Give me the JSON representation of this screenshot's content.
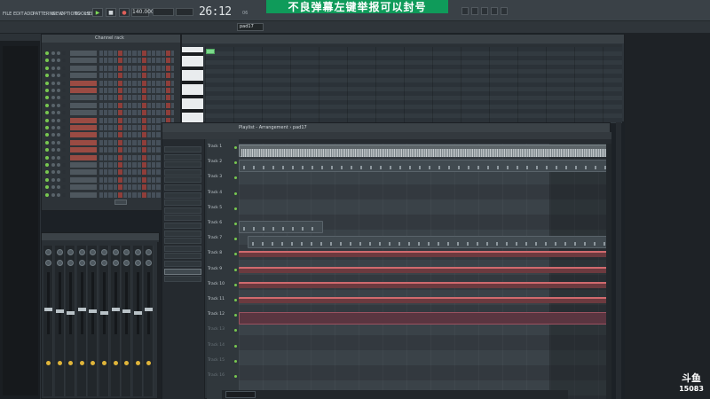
{
  "menubar": {
    "items": [
      "FILE",
      "EDIT",
      "ADD",
      "PATTERNS",
      "VIEW",
      "OPTIONS",
      "TOOLS",
      "HELP"
    ],
    "tempo": "140.000",
    "time": "26:12",
    "time_sub": "06",
    "pattern": "pad17"
  },
  "danmu": {
    "text": "不良弹幕左键举报可以封号"
  },
  "hint": {
    "line1": "",
    "line2": ""
  },
  "rack": {
    "title": "Channel rack",
    "channels": [
      {
        "name": "",
        "highlight": false
      },
      {
        "name": "",
        "highlight": false
      },
      {
        "name": "",
        "highlight": false
      },
      {
        "name": "",
        "highlight": false
      },
      {
        "name": "",
        "highlight": true
      },
      {
        "name": "",
        "highlight": true
      },
      {
        "name": "",
        "highlight": false
      },
      {
        "name": "",
        "highlight": false
      },
      {
        "name": "",
        "highlight": false
      },
      {
        "name": "",
        "highlight": true
      },
      {
        "name": "",
        "highlight": true
      },
      {
        "name": "",
        "highlight": true
      },
      {
        "name": "",
        "highlight": true
      },
      {
        "name": "",
        "highlight": true
      },
      {
        "name": "",
        "highlight": true
      },
      {
        "name": "",
        "highlight": false
      },
      {
        "name": "",
        "highlight": false
      },
      {
        "name": "",
        "highlight": false
      },
      {
        "name": "",
        "highlight": false
      },
      {
        "name": "",
        "highlight": false
      }
    ]
  },
  "mixer": {
    "title": ""
  },
  "piano": {
    "title": ""
  },
  "playlist": {
    "title": "Playlist - Arrangement › pad17",
    "picker": [
      "",
      "",
      "",
      "",
      "",
      "",
      "",
      "",
      "",
      "",
      "",
      "",
      "",
      "",
      "",
      "",
      "",
      ""
    ],
    "picker_selected": 16,
    "tracks": [
      "Track 1",
      "Track 2",
      "Track 3",
      "Track 4",
      "Track 5",
      "Track 6",
      "Track 7",
      "Track 8",
      "Track 9",
      "Track 10",
      "Track 11",
      "Track 12",
      "Track 13",
      "Track 14",
      "Track 15",
      "Track 16"
    ],
    "clips": [
      {
        "track": 0,
        "kind": "audio",
        "name": ""
      },
      {
        "track": 1,
        "kind": "pattern",
        "name": ""
      },
      {
        "track": 5,
        "kind": "pattern",
        "name": ""
      },
      {
        "track": 6,
        "kind": "pattern",
        "name": ""
      },
      {
        "track": 7,
        "kind": "auto",
        "name": ""
      },
      {
        "track": 8,
        "kind": "auto",
        "name": ""
      },
      {
        "track": 9,
        "kind": "auto",
        "name": ""
      },
      {
        "track": 10,
        "kind": "auto",
        "name": ""
      },
      {
        "track": 11,
        "kind": "auto2",
        "name": ""
      }
    ]
  },
  "status": {
    "text": ""
  },
  "watermark": {
    "logo": "斗鱼",
    "room": "15083"
  }
}
